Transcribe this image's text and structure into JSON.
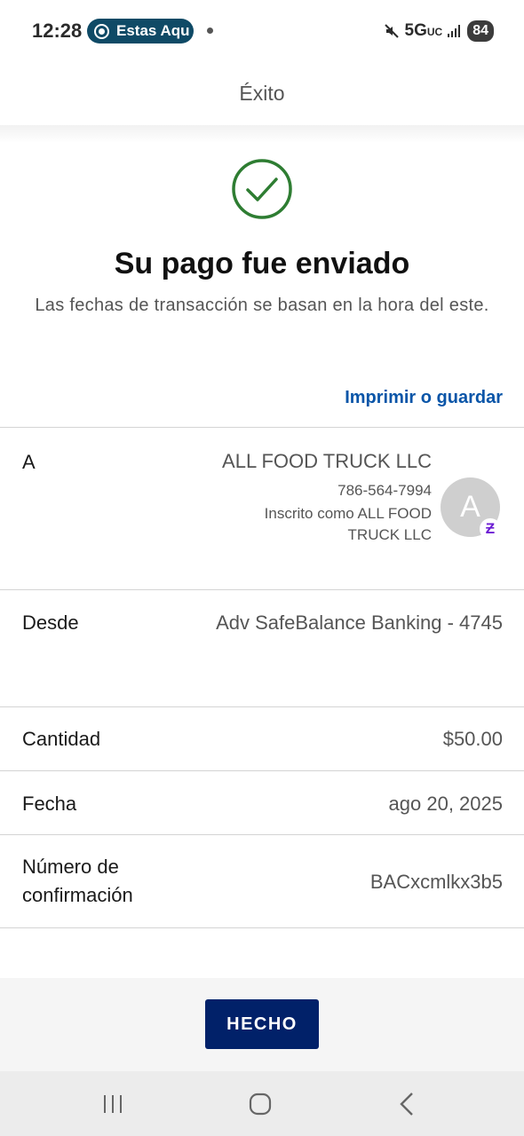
{
  "status_bar": {
    "time": "12:28",
    "pill_label": "Estas Aqu",
    "network": "5G",
    "network_suffix": "UC",
    "battery": "84"
  },
  "header": {
    "title": "Éxito"
  },
  "success": {
    "title": "Su pago fue enviado",
    "subtitle": "Las fechas de transacción se basan en la hora del este.",
    "print_link": "Imprimir o guardar",
    "icon": "check-circle-icon",
    "icon_color": "#2e7d32"
  },
  "details": {
    "to": {
      "label": "A",
      "name": "ALL FOOD TRUCK LLC",
      "phone": "786-564-7994",
      "enrolled": "Inscrito como ALL FOOD TRUCK LLC",
      "avatar_initial": "A",
      "badge": "Ƶ"
    },
    "from": {
      "label": "Desde",
      "value": "Adv SafeBalance Banking - 4745"
    },
    "amount": {
      "label": "Cantidad",
      "value": "$50.00"
    },
    "date": {
      "label": "Fecha",
      "value": "ago 20, 2025"
    },
    "confirmation": {
      "label": "Número de confirmación",
      "value": "BACxcmlkx3b5"
    }
  },
  "actions": {
    "done_label": "HECHO"
  },
  "colors": {
    "primary_button": "#012169",
    "link": "#0a55a8",
    "zelle": "#6d1ed4"
  }
}
